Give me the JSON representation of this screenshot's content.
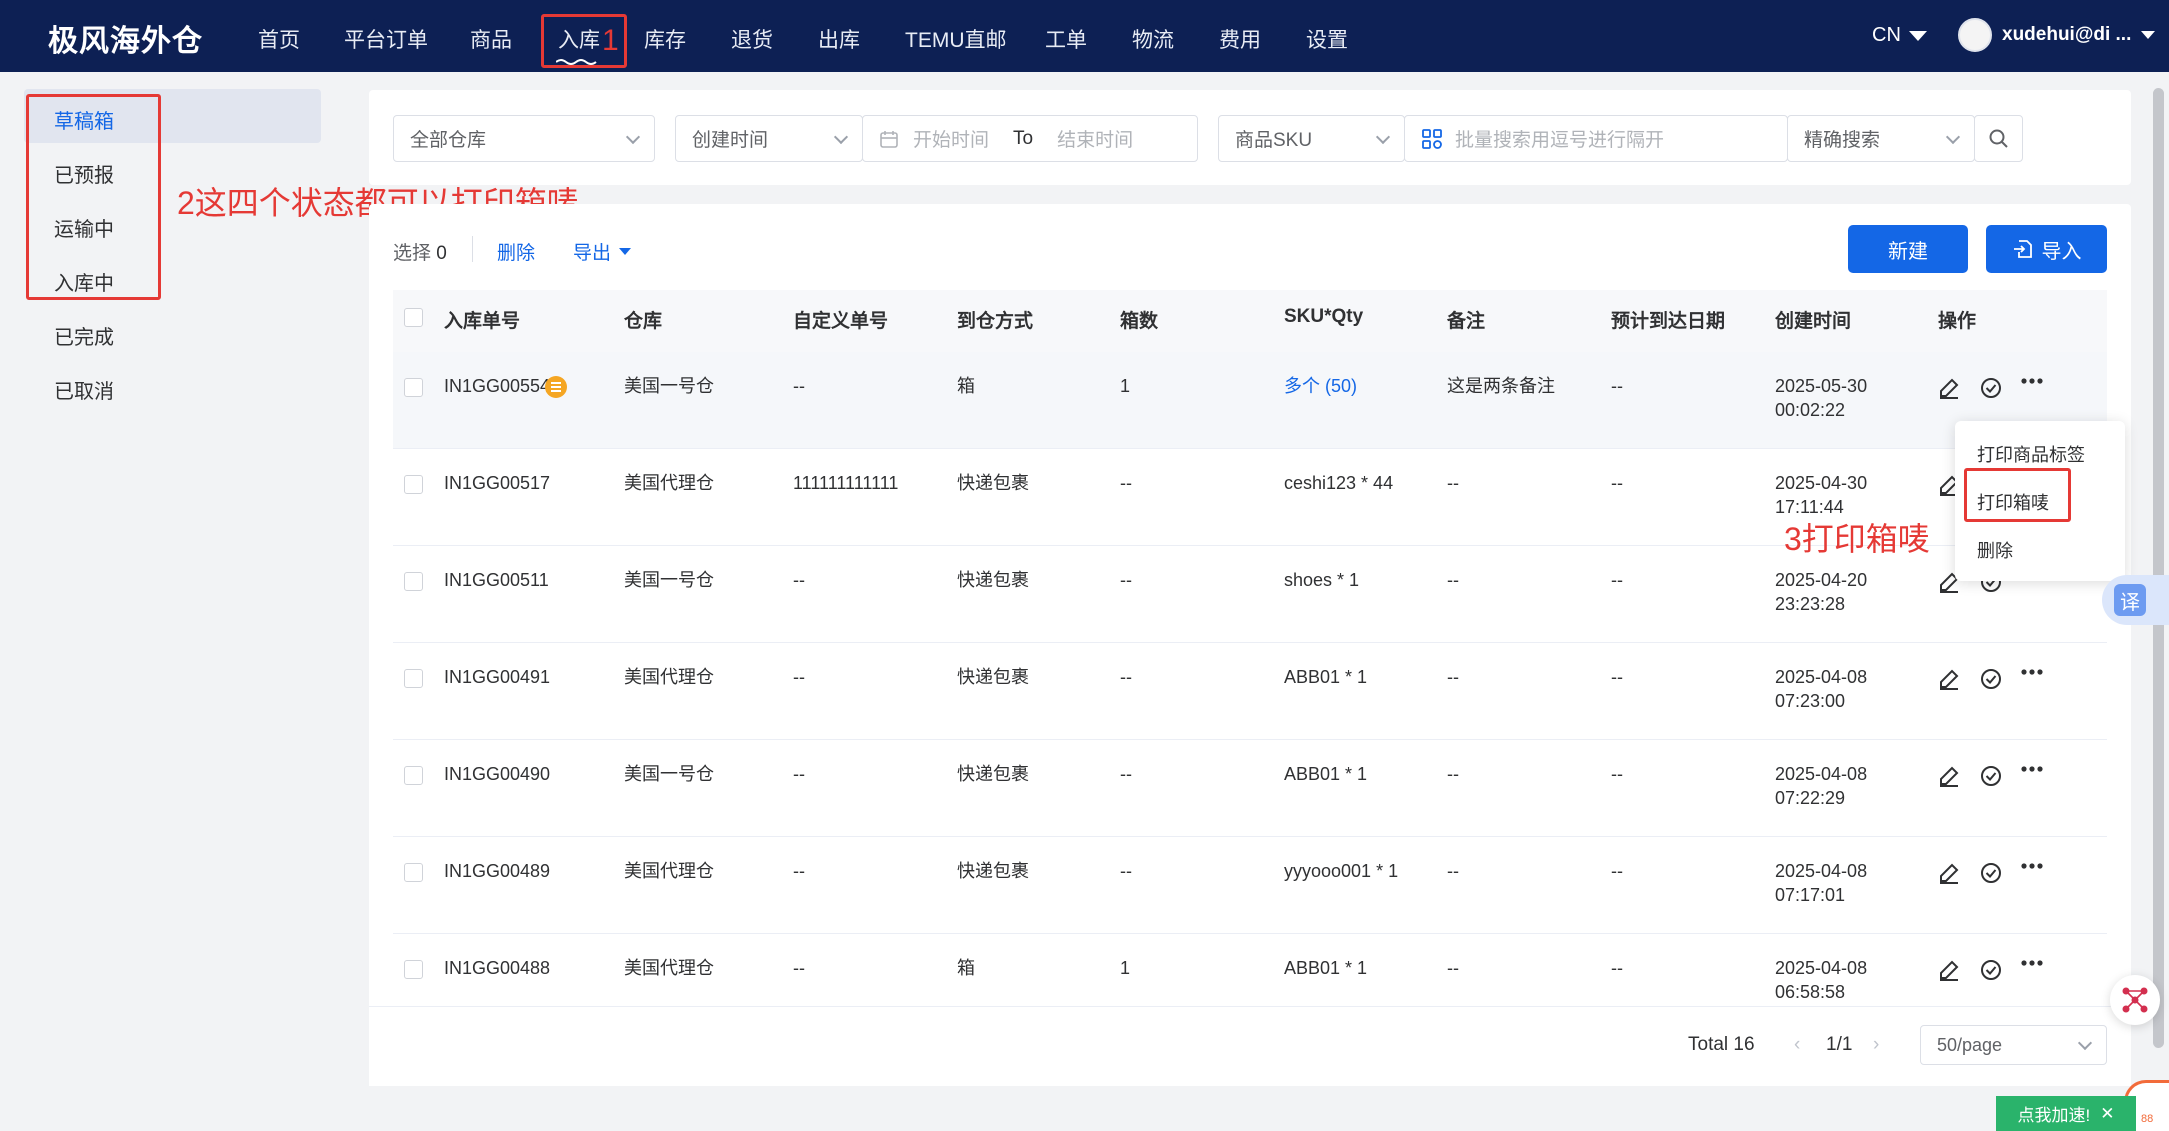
{
  "nav": {
    "logo": "极风海外仓",
    "items": [
      "首页",
      "平台订单",
      "商品",
      "入库",
      "库存",
      "退货",
      "出库",
      "TEMU直邮",
      "工单",
      "物流",
      "费用",
      "设置"
    ],
    "active": "入库",
    "lang": "CN",
    "user": "xudehui@di ..."
  },
  "annotations": {
    "a1": "1",
    "a2": "2这四个状态都可以打印箱唛",
    "a3": "3打印箱唛"
  },
  "sidebar": {
    "items": [
      "草稿箱",
      "已预报",
      "运输中",
      "入库中",
      "已完成",
      "已取消"
    ],
    "active": "草稿箱"
  },
  "filters": {
    "warehouse": "全部仓库",
    "time_type": "创建时间",
    "start_placeholder": "开始时间",
    "to": "To",
    "end_placeholder": "结束时间",
    "sku_type": "商品SKU",
    "batch_placeholder": "批量搜索用逗号进行隔开",
    "search_mode": "精确搜索"
  },
  "toolbar": {
    "select_label": "选择",
    "select_count": "0",
    "delete": "删除",
    "export": "导出",
    "new": "新建",
    "import": "导入"
  },
  "table": {
    "headers": [
      "入库单号",
      "仓库",
      "自定义单号",
      "到仓方式",
      "箱数",
      "SKU*Qty",
      "备注",
      "预计到达日期",
      "创建时间",
      "操作"
    ],
    "rows": [
      {
        "no": "IN1GG00554",
        "wh": "美国一号仓",
        "custom": "--",
        "method": "箱",
        "boxes": "1",
        "sku": "多个 (50)",
        "remark": "这是两条备注",
        "eta": "--",
        "date": "2025-05-30",
        "time": "00:02:22"
      },
      {
        "no": "IN1GG00517",
        "wh": "美国代理仓",
        "custom": "111111111111",
        "method": "快递包裹",
        "boxes": "--",
        "sku": "ceshi123 * 44",
        "remark": "--",
        "eta": "--",
        "date": "2025-04-30",
        "time": "17:11:44"
      },
      {
        "no": "IN1GG00511",
        "wh": "美国一号仓",
        "custom": "--",
        "method": "快递包裹",
        "boxes": "--",
        "sku": "shoes * 1",
        "remark": "--",
        "eta": "--",
        "date": "2025-04-20",
        "time": "23:23:28"
      },
      {
        "no": "IN1GG00491",
        "wh": "美国代理仓",
        "custom": "--",
        "method": "快递包裹",
        "boxes": "--",
        "sku": "ABB01 * 1",
        "remark": "--",
        "eta": "--",
        "date": "2025-04-08",
        "time": "07:23:00"
      },
      {
        "no": "IN1GG00490",
        "wh": "美国一号仓",
        "custom": "--",
        "method": "快递包裹",
        "boxes": "--",
        "sku": "ABB01 * 1",
        "remark": "--",
        "eta": "--",
        "date": "2025-04-08",
        "time": "07:22:29"
      },
      {
        "no": "IN1GG00489",
        "wh": "美国代理仓",
        "custom": "--",
        "method": "快递包裹",
        "boxes": "--",
        "sku": "yyyooo001 * 1",
        "remark": "--",
        "eta": "--",
        "date": "2025-04-08",
        "time": "07:17:01"
      },
      {
        "no": "IN1GG00488",
        "wh": "美国代理仓",
        "custom": "--",
        "method": "箱",
        "boxes": "1",
        "sku": "ABB01 * 1",
        "remark": "--",
        "eta": "--",
        "date": "2025-04-08",
        "time": "06:58:58"
      }
    ]
  },
  "dropdown": {
    "items": [
      "打印商品标签",
      "打印箱唛",
      "删除"
    ]
  },
  "pagination": {
    "total": "Total 16",
    "page": "1/1",
    "page_size": "50/page"
  },
  "widgets": {
    "translate": "译",
    "speedup": "点我加速!",
    "close": "✕",
    "badge": "88"
  },
  "colors": {
    "nav_bg": "#0d2054",
    "primary": "#1467e6",
    "annotation": "#e53935",
    "badge_orange": "#f5a623",
    "green": "#2ab36b"
  }
}
